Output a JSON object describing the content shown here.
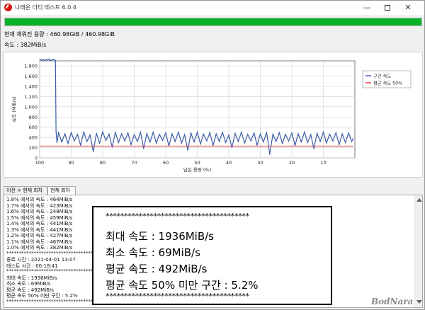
{
  "window": {
    "title": "나래온 더티 테스트 6.0.4",
    "minimize_symbol": "—",
    "close_symbol": "✕"
  },
  "progress": {
    "fraction": 1.0,
    "color": "#06b025"
  },
  "status": {
    "capacity": "현재 채워진 용량 : 460.98GiB / 460.98GiB",
    "speed": "속도 : 382MiB/s"
  },
  "chart_data": {
    "type": "line",
    "xlabel": "남은 용량 (%)",
    "ylabel": "속도 (MiB/s)",
    "xlim": [
      100,
      0
    ],
    "x_ticks": [
      100,
      90,
      80,
      70,
      60,
      50,
      40,
      30,
      20,
      10
    ],
    "ylim": [
      0,
      1900
    ],
    "y_ticks": [
      0,
      200,
      400,
      600,
      800,
      1000,
      1200,
      1400,
      1600,
      1800
    ],
    "y_tick_labels": [
      "0",
      "200",
      "400",
      "600",
      "800",
      "1,000",
      "1,200",
      "1,400",
      "1,600",
      "1,800"
    ],
    "grid": true,
    "legend_position": "right",
    "series": [
      {
        "name": "구간 속도",
        "color": "#3a5ca8",
        "x": [
          100,
          99.5,
          99,
          98.5,
          98,
          97.5,
          97,
          96.5,
          96,
          95.5,
          95,
          94.8,
          94.5,
          94,
          93,
          92,
          91,
          90,
          89,
          88,
          87,
          86,
          85,
          84,
          83,
          82,
          81,
          80,
          79,
          78,
          77,
          76,
          75,
          74,
          73,
          72,
          71,
          70,
          69,
          68,
          67,
          66,
          65,
          64,
          63,
          62,
          61,
          60,
          59,
          58,
          57,
          56,
          55,
          54,
          53,
          52,
          51,
          50,
          49,
          48,
          47,
          46,
          45,
          44,
          43,
          42,
          41,
          40,
          39,
          38,
          37,
          36,
          35,
          34,
          33,
          32,
          31,
          30,
          29,
          28,
          27,
          26,
          25,
          24,
          23,
          22,
          21,
          20,
          19,
          18,
          17,
          16,
          15,
          14,
          13,
          12,
          11,
          10,
          9,
          8,
          7,
          6,
          5,
          4,
          3,
          2,
          1,
          0.5
        ],
        "y": [
          1936,
          1910,
          1930,
          1900,
          1925,
          1915,
          1936,
          1905,
          1920,
          1930,
          1910,
          520,
          300,
          500,
          310,
          470,
          280,
          495,
          330,
          460,
          250,
          505,
          320,
          450,
          120,
          480,
          290,
          510,
          340,
          465,
          210,
          500,
          300,
          470,
          330,
          490,
          260,
          455,
          320,
          500,
          180,
          475,
          310,
          500,
          290,
          460,
          340,
          490,
          230,
          470,
          320,
          505,
          290,
          455,
          150,
          485,
          310,
          500,
          270,
          465,
          330,
          495,
          240,
          470,
          320,
          500,
          300,
          450,
          200,
          480,
          320,
          505,
          290,
          460,
          330,
          490,
          250,
          470,
          310,
          500,
          69,
          465,
          320,
          495,
          280,
          460,
          330,
          490,
          240,
          470,
          310,
          505,
          300,
          455,
          180,
          480,
          320,
          500,
          290,
          465,
          330,
          495,
          260,
          470,
          300,
          490,
          320,
          382
        ]
      },
      {
        "name": "평균 속도 50%",
        "color": "#e04040",
        "x": [
          100,
          0.5
        ],
        "y": [
          230,
          230
        ]
      }
    ]
  },
  "tabs": {
    "previous": "이전 + 현재 회차",
    "current": "현재 회차"
  },
  "log": {
    "lines": [
      "1.8% 에서의 속도 : 464MiB/s",
      "1.7% 에서의 속도 : 423MiB/s",
      "1.6% 에서의 속도 : 248MiB/s",
      "1.5% 에서의 속도 : 459MiB/s",
      "1.4% 에서의 속도 : 441MiB/s",
      "1.3% 에서의 속도 : 441MiB/s",
      "1.2% 에서의 속도 : 427MiB/s",
      "1.1% 에서의 속도 : 467MiB/s",
      "1.0% 에서의 속도 : 382MiB/s",
      "**************************************",
      "종료 시간 : 2021-04-01 13:07",
      "테스트 시간 : 00:18:41",
      "**************************************",
      "최대 속도 : 1936MiB/s",
      "최소 속도 : 69MiB/s",
      "평균 속도 : 492MiB/s",
      "평균 속도 50% 미만 구간 : 5.2%",
      "**************************************"
    ]
  },
  "summary": {
    "stars": "***************************************",
    "max": "최대 속도 : 1936MiB/s",
    "min": "최소 속도 : 69MiB/s",
    "avg": "평균 속도 : 492MiB/s",
    "below": "평균 속도 50% 미만 구간 : 5.2%"
  },
  "watermark": "BodNara"
}
